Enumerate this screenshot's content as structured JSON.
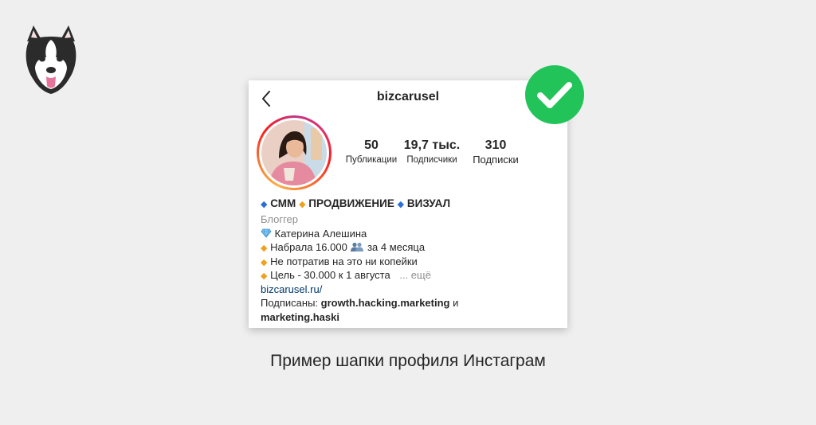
{
  "colors": {
    "background": "#efefef",
    "card": "#ffffff",
    "check_green": "#22c45a",
    "text": "#262626",
    "muted": "#8e8e8e",
    "link": "#00376b",
    "diamond_blue": "#2a6fd6",
    "diamond_orange": "#f0a020"
  },
  "icons": {
    "logo": "husky-head-icon",
    "back": "chevron-left-icon",
    "check": "check-circle-icon",
    "gem": "gem-icon",
    "people": "people-icon"
  },
  "profile": {
    "username": "bizcarusel",
    "stats": [
      {
        "value": "50",
        "label": "Публикации"
      },
      {
        "value": "19,7 тыс.",
        "label": "Подписчики"
      },
      {
        "value": "310",
        "label": "Подписки"
      }
    ],
    "bio": {
      "title": {
        "part1": "СММ",
        "part2": "ПРОДВИЖЕНИЕ",
        "part3": "ВИЗУАЛ"
      },
      "category": "Блоггер",
      "name": "Катерина Алешина",
      "line2_a": "Набрала 16.000",
      "line2_b": "за 4 месяца",
      "line3": "Не потратив на это ни копейки",
      "line4": "Цель - 30.000 к 1 августа",
      "more": "... ещё",
      "website": "bizcarusel.ru/",
      "followed_prefix": "Подписаны:",
      "followed_user1": "growth.hacking.marketing",
      "followed_and": "и",
      "followed_user2": "marketing.haski"
    }
  },
  "caption": "Пример шапки профиля Инстаграм"
}
